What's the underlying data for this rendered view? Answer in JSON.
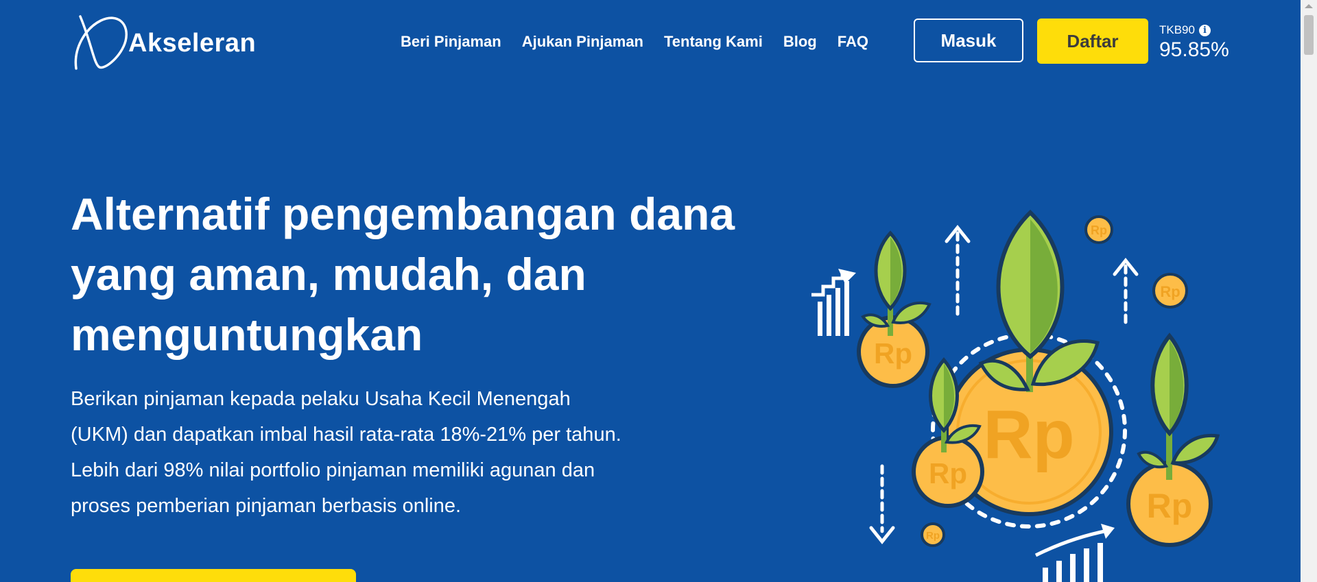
{
  "brand": {
    "name": "Akseleran"
  },
  "nav": {
    "items": [
      {
        "label": "Beri Pinjaman"
      },
      {
        "label": "Ajukan Pinjaman"
      },
      {
        "label": "Tentang Kami"
      },
      {
        "label": "Blog"
      },
      {
        "label": "FAQ"
      }
    ],
    "login_label": "Masuk",
    "register_label": "Daftar"
  },
  "tkb": {
    "label": "TKB90",
    "value": "95.85%"
  },
  "hero": {
    "title_lines": [
      "Alternatif pengembangan dana",
      "yang aman, mudah, dan",
      "menguntungkan"
    ],
    "description_lines": [
      "Berikan pinjaman kepada pelaku Usaha Kecil Menengah",
      "(UKM) dan dapatkan imbal hasil rata-rata 18%-21% per tahun.",
      "Lebih dari 98% nilai portfolio pinjaman memiliki agunan dan",
      "proses pemberian pinjaman berbasis online."
    ]
  },
  "illustration": {
    "coin_label": "Rp"
  },
  "colors": {
    "background": "#0d52a3",
    "accent_yellow": "#fedd0a",
    "coin": "#fdbd48",
    "leaf_light": "#a6cf4d",
    "leaf_dark": "#78ad3a"
  }
}
